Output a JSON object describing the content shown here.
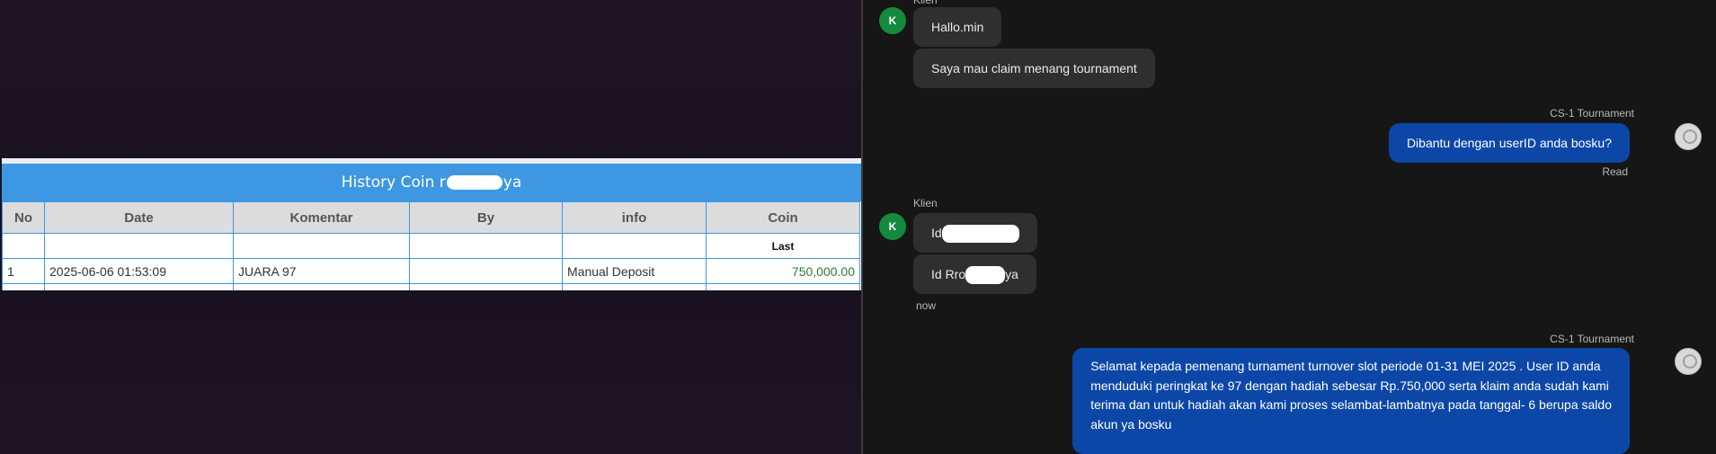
{
  "history": {
    "title_prefix": "History Coin r",
    "title_suffix": "ya",
    "columns": [
      "No",
      "Date",
      "Komentar",
      "By",
      "info",
      "Coin"
    ],
    "subheader_coin": "Last",
    "rows": [
      {
        "no": "1",
        "date": "2025-06-06 01:53:09",
        "komentar": "JUARA 97",
        "by": "",
        "info": "Manual Deposit",
        "coin": "750,000.00"
      }
    ]
  },
  "chat": {
    "client_name": "Klien",
    "client_avatar": "K",
    "agent_name": "CS-1 Tournament",
    "messages": {
      "m1": "Hallo.min",
      "m2": "Saya mau claim menang tournament",
      "m3": "Dibantu dengan userID anda bosku?",
      "m3_status": "Read",
      "m4_prefix": "Id",
      "m5_prefix": "Id Rro",
      "m5_suffix": "ya",
      "m5_time": "now",
      "m6_lines": [
        "Selamat kepada pemenang turnament turnover slot periode 01-31 MEI 2025 . User ID anda",
        "menduduki peringkat ke 97 dengan hadiah sebesar Rp.750,000 serta klaim anda sudah kami",
        "terima dan untuk hadiah akan kami proses selambat-lambatnya pada tanggal- 6 berupa saldo",
        "akun ya bosku"
      ]
    }
  },
  "colors": {
    "header_blue": "#3d97e3",
    "agent_bubble": "#0c47a8",
    "client_bubble": "#2f2f2f",
    "client_avatar": "#138a3c",
    "coin_green": "#2e7d32"
  }
}
